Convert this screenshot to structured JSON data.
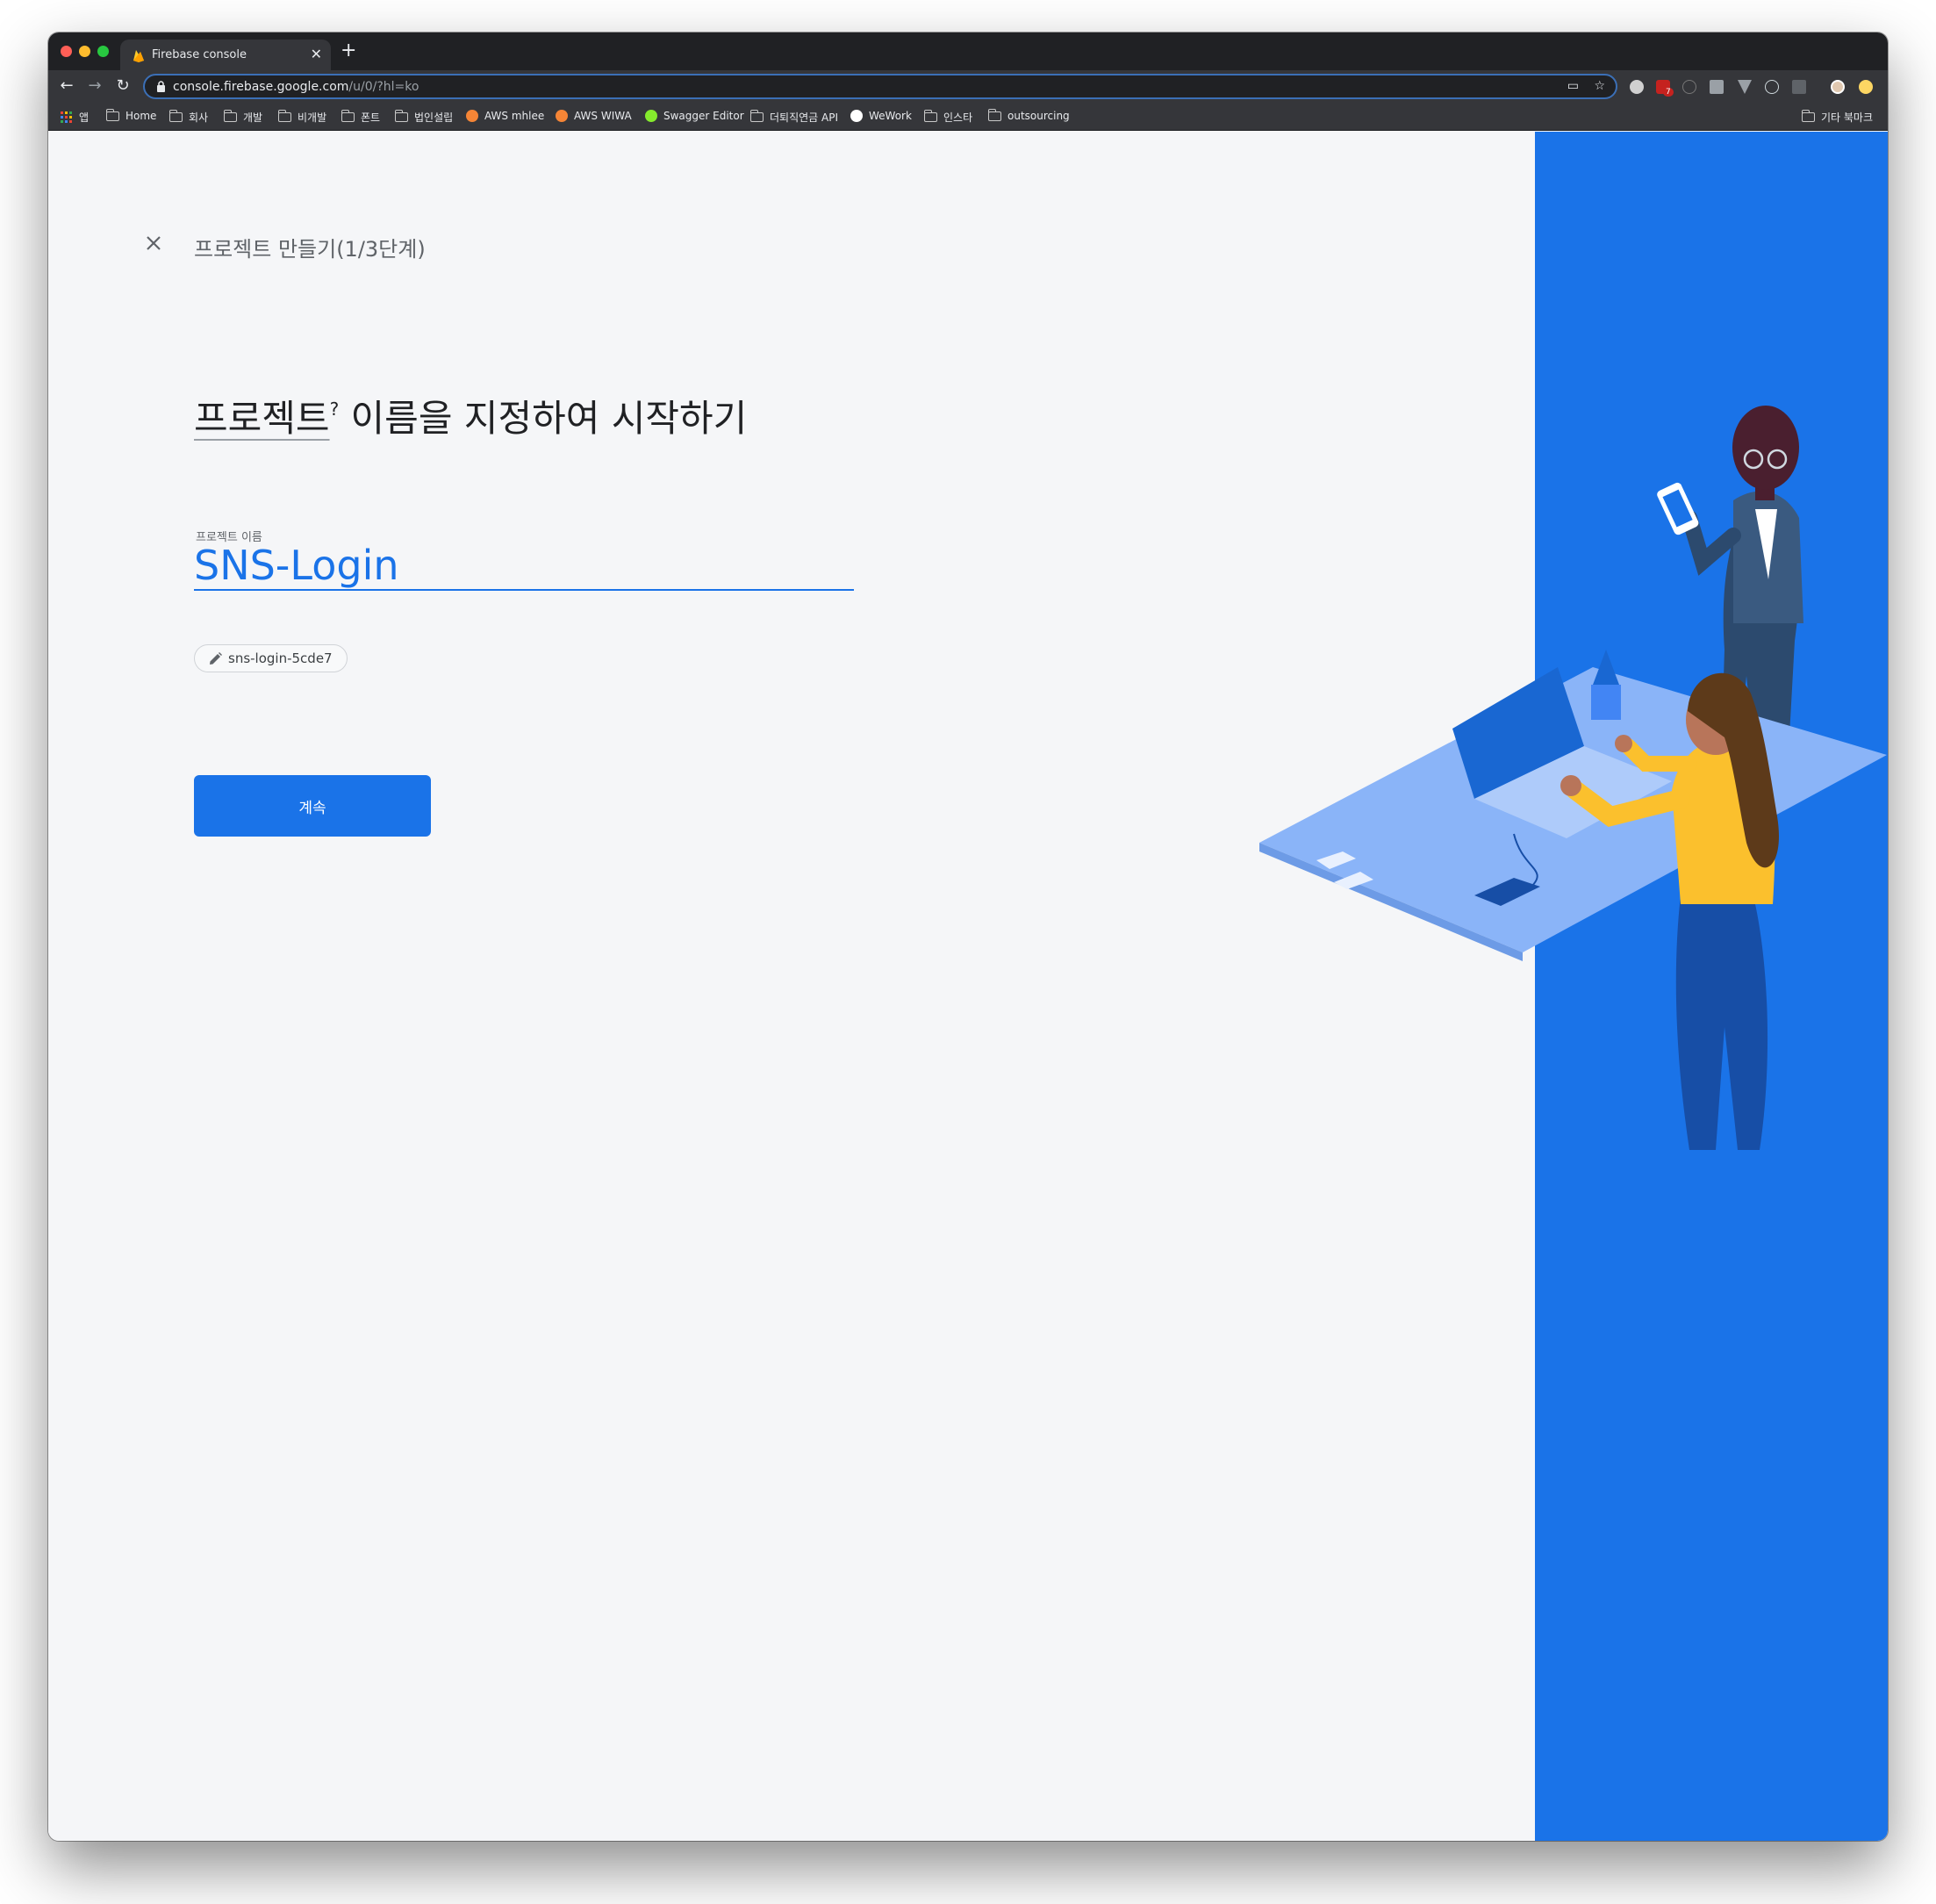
{
  "browser": {
    "tab_title": "Firebase console",
    "url_host": "console.firebase.google.com",
    "url_path": "/u/0/?hl=ko",
    "bookmarks": [
      "앱",
      "Home",
      "회사",
      "개발",
      "비개발",
      "폰트",
      "법인설립",
      "AWS mhlee",
      "AWS WIWA",
      "Swagger Editor",
      "더퇴직연금 API",
      "WeWork",
      "인스타",
      "outsourcing"
    ],
    "other_bookmarks": "기타 북마크",
    "extension_badge": "7"
  },
  "wizard": {
    "step_title": "프로젝트 만들기(1/3단계)",
    "headline_term": "프로젝트",
    "headline_help_mark": "?",
    "headline_rest": " 이름을 지정하여 시작하기",
    "field_label": "프로젝트 이름",
    "project_name": "SNS-Login",
    "project_id": "sns-login-5cde7",
    "continue_label": "계속"
  },
  "colors": {
    "accent": "#1a73e8",
    "browser_dark": "#202124",
    "page_bg": "#f5f6f8"
  }
}
